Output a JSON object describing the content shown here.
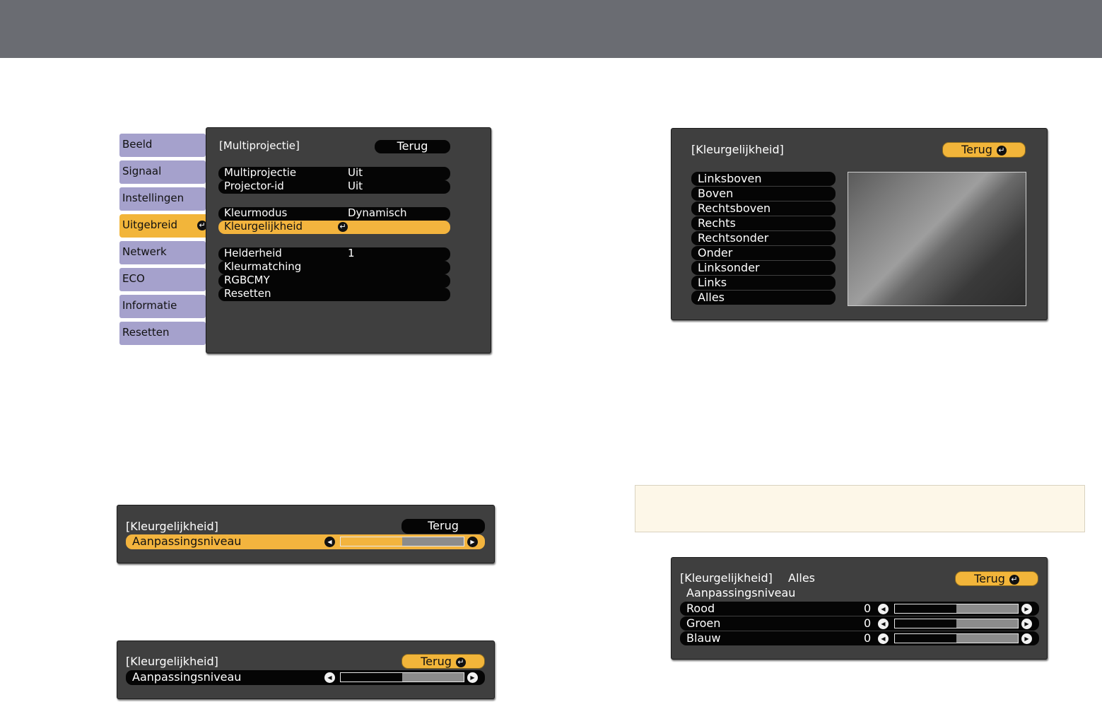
{
  "menu": {
    "tabs": [
      {
        "label": "Beeld"
      },
      {
        "label": "Signaal"
      },
      {
        "label": "Instellingen"
      },
      {
        "label": "Uitgebreid",
        "active": true
      },
      {
        "label": "Netwerk"
      },
      {
        "label": "ECO"
      },
      {
        "label": "Informatie"
      },
      {
        "label": "Resetten"
      }
    ],
    "title": "[Multiprojectie]",
    "back": "Terug",
    "rows": [
      {
        "label": "Multiprojectie",
        "value": "Uit"
      },
      {
        "label": "Projector-id",
        "value": "Uit"
      },
      {
        "label": "Kleurmodus",
        "value": "Dynamisch"
      },
      {
        "label": "Kleurgelijkheid",
        "value": ""
      },
      {
        "label": "Helderheid",
        "value": "1"
      },
      {
        "label": "Kleurmatching",
        "value": ""
      },
      {
        "label": "RGBCMY",
        "value": ""
      },
      {
        "label": "Resetten",
        "value": ""
      }
    ]
  },
  "area_menu": {
    "title": "[Kleurgelijkheid]",
    "back": "Terug",
    "items": [
      "Linksboven",
      "Boven",
      "Rechtsboven",
      "Rechts",
      "Rechtsonder",
      "Onder",
      "Linksonder",
      "Links",
      "Alles"
    ]
  },
  "level_a": {
    "title": "[Kleurgelijkheid]",
    "back": "Terug",
    "label": "Aanpassingsniveau",
    "level": 0.5
  },
  "level_b": {
    "title": "[Kleurgelijkheid]",
    "back": "Terug",
    "label": "Aanpassingsniveau",
    "level": 0.5
  },
  "rgb_panel": {
    "title": "[Kleurgelijkheid]",
    "area": "Alles",
    "back": "Terug",
    "subtitle": "Aanpassingsniveau",
    "rows": [
      {
        "label": "Rood",
        "value": "0",
        "level": 0.5
      },
      {
        "label": "Groen",
        "value": "0",
        "level": 0.5
      },
      {
        "label": "Blauw",
        "value": "0",
        "level": 0.5
      }
    ]
  },
  "icons": {
    "enter": "enter-icon",
    "left": "arrow-left-icon",
    "right": "arrow-right-icon"
  },
  "colors": {
    "highlight": "#f2b53a",
    "tab": "#a5a1cc",
    "panel": "#3f3f3f",
    "header": "#6a6c72"
  }
}
